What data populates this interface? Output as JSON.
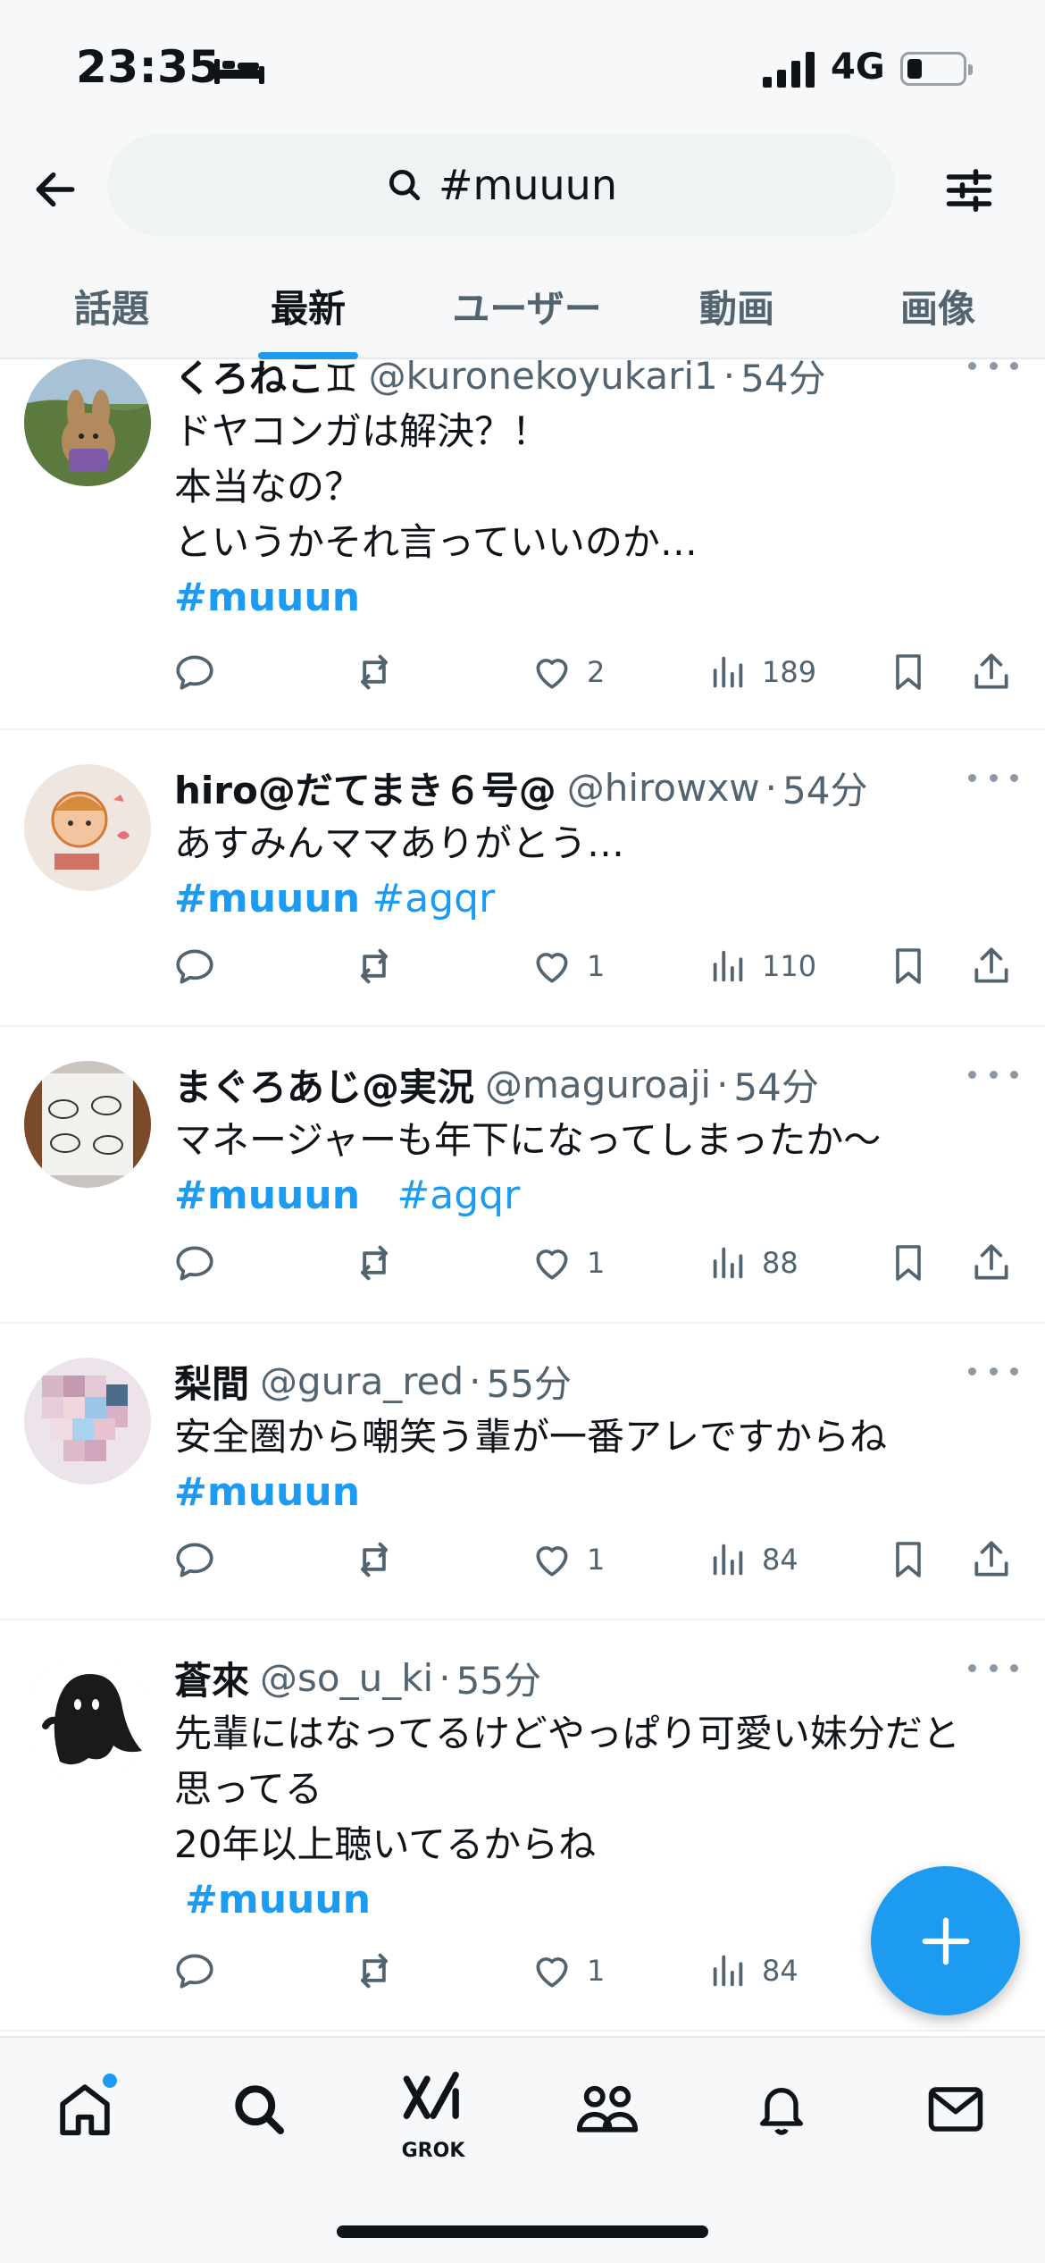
{
  "status_bar": {
    "time": "23:35",
    "network": "4G",
    "icons": [
      "bed-icon",
      "signal-icon",
      "battery-icon"
    ]
  },
  "search": {
    "query": "#muuun",
    "icons": [
      "back-arrow-icon",
      "search-icon",
      "filter-sliders-icon"
    ]
  },
  "tabs": [
    {
      "label": "話題",
      "active": false
    },
    {
      "label": "最新",
      "active": true
    },
    {
      "label": "ユーザー",
      "active": false
    },
    {
      "label": "動画",
      "active": false
    },
    {
      "label": "画像",
      "active": false
    }
  ],
  "tweets": [
    {
      "name": "くろねこ♊",
      "handle": "@kuronekoyukari1",
      "time": "54分",
      "lines": [
        "ドヤコンガは解決？！",
        "本当なの？",
        "というかそれ言っていいのか…"
      ],
      "tags_line": "#muuun",
      "likes": "2",
      "views": "189"
    },
    {
      "name": "hiro@だてまき６号@",
      "handle": "@hirowxw",
      "time": "54分",
      "lines": [
        "あすみんママありがとう…"
      ],
      "tags": [
        "#muuun",
        "#agqr"
      ],
      "likes": "1",
      "views": "110"
    },
    {
      "name": "まぐろあじ@実況",
      "handle": "@maguroaji",
      "time": "54分",
      "lines": [
        "マネージャーも年下になってしまったか〜"
      ],
      "tags": [
        "#muuun",
        "#agqr"
      ],
      "likes": "1",
      "views": "88"
    },
    {
      "name": "梨間",
      "handle": "@gura_red",
      "time": "55分",
      "lines": [
        "安全圏から嘲笑う輩が一番アレですからね"
      ],
      "tags_line": "#muuun",
      "likes": "1",
      "views": "84"
    },
    {
      "name": "蒼來",
      "handle": "@so_u_ki",
      "time": "55分",
      "lines": [
        "先輩にはなってるけどやっぱり可愛い妹分だと",
        "思ってる",
        "20年以上聴いてるからね"
      ],
      "tags_line": "#muuun",
      "likes": "1",
      "views": "84"
    }
  ],
  "separator": "·",
  "bottom_nav": {
    "items": [
      "home-icon",
      "search-icon",
      "grok-icon",
      "communities-icon",
      "notifications-icon",
      "messages-icon"
    ],
    "grok_label": "GROK"
  },
  "colors": {
    "accent": "#1d9bf0",
    "text": "#0f1419",
    "muted": "#536471",
    "bar_bg": "#f7f8f9"
  }
}
